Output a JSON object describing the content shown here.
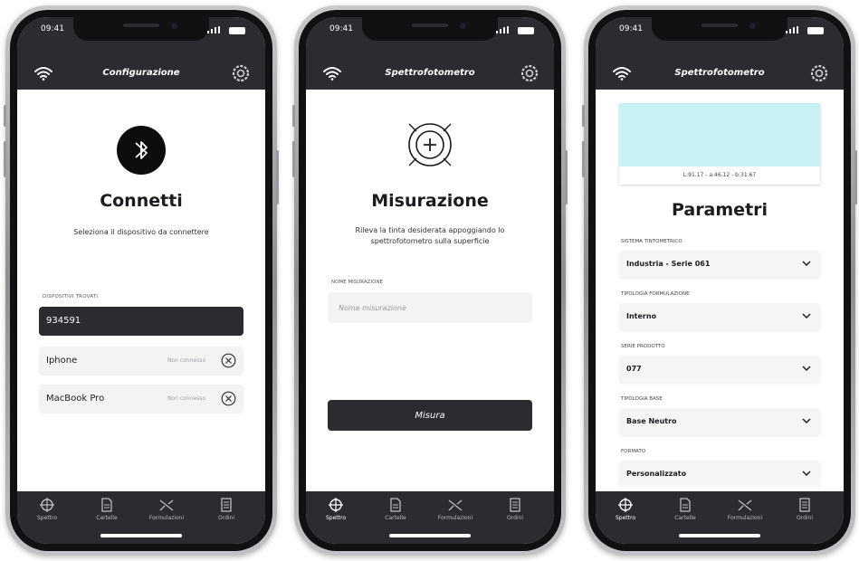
{
  "status": {
    "time": "09:41"
  },
  "tabs": [
    {
      "icon": "crosshair-icon",
      "label": "Spettro"
    },
    {
      "icon": "document-icon",
      "label": "Cartelle"
    },
    {
      "icon": "shuffle-icon",
      "label": "Formulazioni"
    },
    {
      "icon": "list-icon",
      "label": "Ordini"
    }
  ],
  "screen1": {
    "header_title": "Configurazione",
    "title": "Connetti",
    "subtitle": "Seleziona il dispositivo da connettere",
    "devices_label": "DISPOSITIVI TROVATI",
    "selected_device": "934591",
    "devices": [
      {
        "name": "Iphone",
        "state": "Non connesso"
      },
      {
        "name": "MacBook Pro",
        "state": "Non connesso"
      }
    ]
  },
  "screen2": {
    "header_title": "Spettrofotometro",
    "title": "Misurazione",
    "subtitle": "Rileva la tinta desiderata appoggiando lo spettrofotometro sulla superficie",
    "field_label": "NOME MISURAZIONE",
    "field_placeholder": "Nome misurazione",
    "button_label": "Misura"
  },
  "screen3": {
    "header_title": "Spettrofotometro",
    "swatch_color": "#c9f2f6",
    "color_values": "L:91.17 - a:46.12 - b:31.67",
    "title": "Parametri",
    "params": [
      {
        "label": "SISTEMA TINTOMETRICO",
        "value": "Industria - Serie 061"
      },
      {
        "label": "TIPOLOGIA FORMULAZIONE",
        "value": "Interno"
      },
      {
        "label": "SERIE PRODOTTO",
        "value": "077"
      },
      {
        "label": "TIPOLOGIA BASE",
        "value": "Base Neutro"
      },
      {
        "label": "FORMATO",
        "value": "Personalizzato"
      }
    ]
  }
}
